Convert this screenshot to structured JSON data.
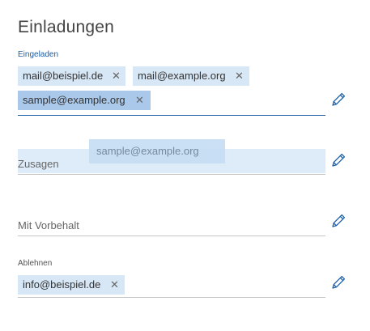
{
  "dialog": {
    "title": "Einladungen"
  },
  "sections": {
    "eingeladen": {
      "label": "Eingeladen",
      "chips": [
        "mail@beispiel.de",
        "mail@example.org",
        "sample@example.org"
      ],
      "selected_chip": "sample@example.org"
    },
    "zusagen": {
      "placeholder": "Zusagen",
      "drag_item": "sample@example.org"
    },
    "vorbehalt": {
      "placeholder": "Mit Vorbehalt"
    },
    "ablehnen": {
      "label": "Ablehnen",
      "chips": [
        "info@beispiel.de"
      ]
    }
  },
  "icons": {
    "edit": "pencil-icon",
    "remove": "close-icon"
  },
  "colors": {
    "accent": "#1b5ea6",
    "chip": "#d7e7f6",
    "chip_selected": "#aac8ea",
    "drop_zone": "#ddecf8"
  }
}
